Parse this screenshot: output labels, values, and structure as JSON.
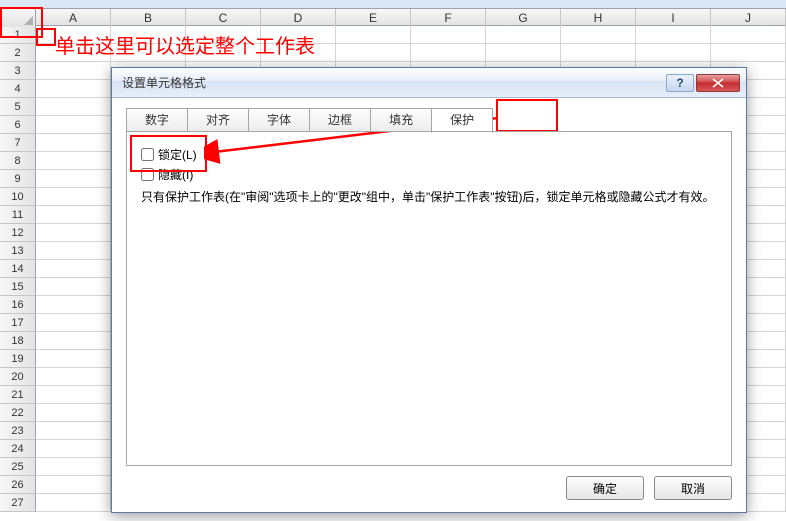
{
  "annotation_text": "单击这里可以选定整个工作表",
  "columns": [
    "A",
    "B",
    "C",
    "D",
    "E",
    "F",
    "G",
    "H",
    "I",
    "J"
  ],
  "row_numbers": [
    1,
    2,
    3,
    4,
    5,
    6,
    7,
    8,
    9,
    10,
    11,
    12,
    13,
    14,
    15,
    16,
    17,
    18,
    19,
    20,
    21,
    22,
    23,
    24,
    25,
    26,
    27
  ],
  "dialog": {
    "title": "设置单元格格式",
    "help_glyph": "?",
    "tabs": {
      "number": "数字",
      "alignment": "对齐",
      "font": "字体",
      "border": "边框",
      "fill": "填充",
      "protection": "保护"
    },
    "lock_label": "锁定(L)",
    "hide_label": "隐藏(I)",
    "note": "只有保护工作表(在\"审阅\"选项卡上的\"更改\"组中，单击\"保护工作表\"按钮)后，锁定单元格或隐藏公式才有效。",
    "ok_label": "确定",
    "cancel_label": "取消"
  }
}
